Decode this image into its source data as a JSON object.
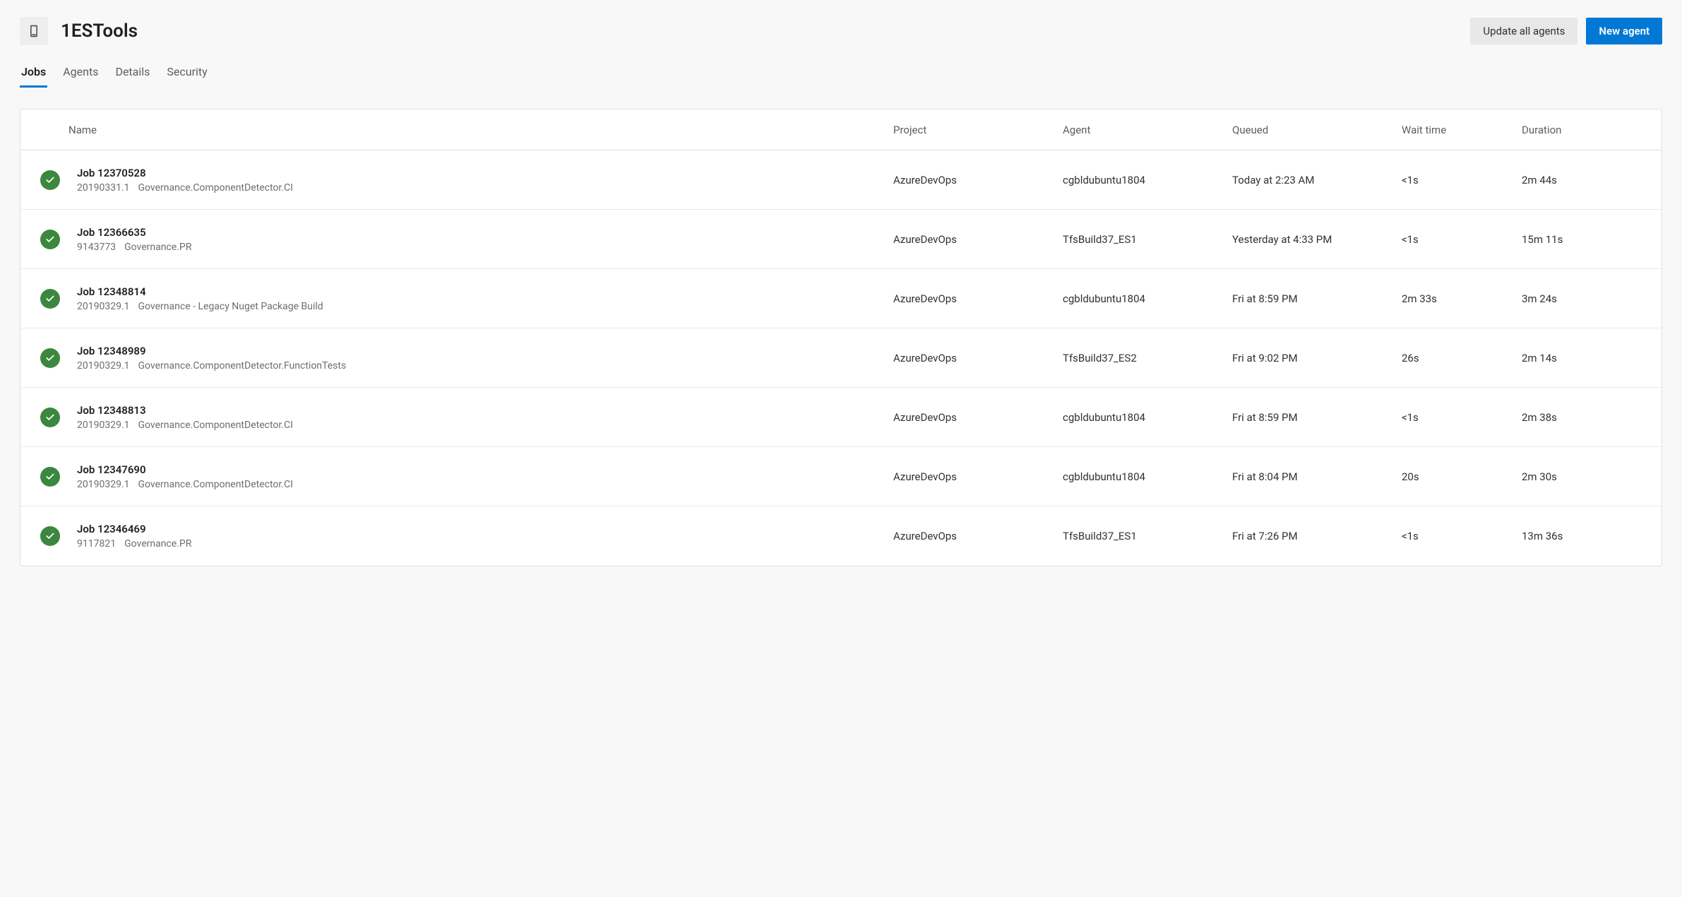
{
  "header": {
    "title": "1ESTools",
    "updateAllLabel": "Update all agents",
    "newAgentLabel": "New agent"
  },
  "tabs": [
    {
      "label": "Jobs",
      "active": true
    },
    {
      "label": "Agents",
      "active": false
    },
    {
      "label": "Details",
      "active": false
    },
    {
      "label": "Security",
      "active": false
    }
  ],
  "columns": {
    "name": "Name",
    "project": "Project",
    "agent": "Agent",
    "queued": "Queued",
    "waitTime": "Wait time",
    "duration": "Duration"
  },
  "jobs": [
    {
      "name": "Job 12370528",
      "buildId": "20190331.1",
      "pipeline": "Governance.ComponentDetector.CI",
      "project": "AzureDevOps",
      "agent": "cgbldubuntu1804",
      "queued": "Today at 2:23 AM",
      "waitTime": "<1s",
      "duration": "2m 44s"
    },
    {
      "name": "Job 12366635",
      "buildId": "9143773",
      "pipeline": "Governance.PR",
      "project": "AzureDevOps",
      "agent": "TfsBuild37_ES1",
      "queued": "Yesterday at 4:33 PM",
      "waitTime": "<1s",
      "duration": "15m 11s"
    },
    {
      "name": "Job 12348814",
      "buildId": "20190329.1",
      "pipeline": "Governance - Legacy Nuget Package Build",
      "project": "AzureDevOps",
      "agent": "cgbldubuntu1804",
      "queued": "Fri at 8:59 PM",
      "waitTime": "2m 33s",
      "duration": "3m 24s"
    },
    {
      "name": "Job 12348989",
      "buildId": "20190329.1",
      "pipeline": "Governance.ComponentDetector.FunctionTests",
      "project": "AzureDevOps",
      "agent": "TfsBuild37_ES2",
      "queued": "Fri at 9:02 PM",
      "waitTime": "26s",
      "duration": "2m 14s"
    },
    {
      "name": "Job 12348813",
      "buildId": "20190329.1",
      "pipeline": "Governance.ComponentDetector.CI",
      "project": "AzureDevOps",
      "agent": "cgbldubuntu1804",
      "queued": "Fri at 8:59 PM",
      "waitTime": "<1s",
      "duration": "2m 38s"
    },
    {
      "name": "Job 12347690",
      "buildId": "20190329.1",
      "pipeline": "Governance.ComponentDetector.CI",
      "project": "AzureDevOps",
      "agent": "cgbldubuntu1804",
      "queued": "Fri at 8:04 PM",
      "waitTime": "20s",
      "duration": "2m 30s"
    },
    {
      "name": "Job 12346469",
      "buildId": "9117821",
      "pipeline": "Governance.PR",
      "project": "AzureDevOps",
      "agent": "TfsBuild37_ES1",
      "queued": "Fri at 7:26 PM",
      "waitTime": "<1s",
      "duration": "13m 36s"
    }
  ]
}
